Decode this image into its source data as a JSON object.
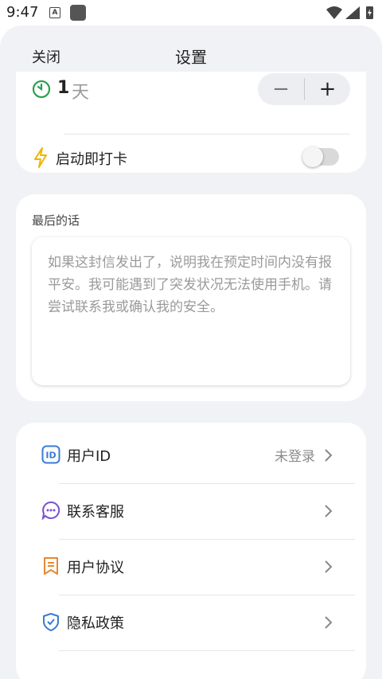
{
  "status_bar": {
    "time": "9:47",
    "a_icon_letter": "A"
  },
  "header": {
    "close_label": "关闭",
    "title": "设置"
  },
  "countdown": {
    "value": "1",
    "unit": "天",
    "minus_label": "−",
    "plus_label": "+"
  },
  "checkin": {
    "label": "启动即打卡",
    "enabled": false
  },
  "last_words": {
    "label": "最后的话",
    "placeholder": "如果这封信发出了，说明我在预定时间内没有报平安。我可能遇到了突发状况无法使用手机。请尝试联系我或确认我的安全。"
  },
  "menu": {
    "items": [
      {
        "label": "用户ID",
        "value": "未登录",
        "icon": "id-badge-icon"
      },
      {
        "label": "联系客服",
        "value": "",
        "icon": "chat-bubble-icon"
      },
      {
        "label": "用户协议",
        "value": "",
        "icon": "bookmark-doc-icon"
      },
      {
        "label": "隐私政策",
        "value": "",
        "icon": "shield-check-icon"
      }
    ]
  },
  "colors": {
    "green": "#2e9e4f",
    "yellow": "#f0b400",
    "blue": "#3a7bd5",
    "purple": "#7b4fd6",
    "orange": "#e68a2e",
    "background": "#f1f2f6"
  }
}
